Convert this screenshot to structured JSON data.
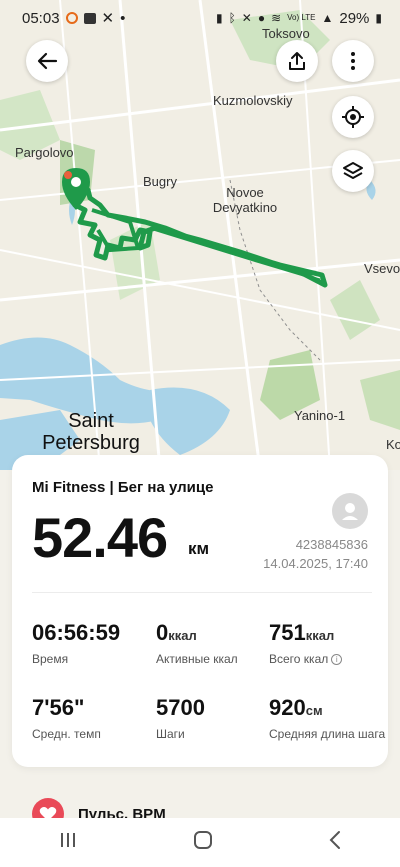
{
  "status_bar": {
    "time": "05:03",
    "battery": "29%",
    "network": "Vo) LTE"
  },
  "map": {
    "labels": {
      "toksovo": "Toksovo",
      "kuzmolovskiy": "Kuzmolovskiy",
      "pargolovo": "Pargolovo",
      "bugry": "Bugry",
      "novoe_devyatkino": "Novoe Devyatkino",
      "vsevo": "Vsevo",
      "saint_petersburg": "Saint Petersburg",
      "yanino": "Yanino-1",
      "ko": "Ko"
    },
    "route_color": "#1f9a4a"
  },
  "card": {
    "title": "Mi Fitness | Бег на улице",
    "distance_value": "52.46",
    "distance_unit": "км",
    "record_id": "4238845836",
    "datetime": "14.04.2025, 17:40",
    "stats": [
      {
        "value": "06:56:59",
        "unit": "",
        "label": "Время"
      },
      {
        "value": "0",
        "unit": "ккал",
        "label": "Активные ккал"
      },
      {
        "value": "751",
        "unit": "ккал",
        "label": "Всего ккал"
      },
      {
        "value": "7'56\"",
        "unit": "",
        "label": "Средн. темп"
      },
      {
        "value": "5700",
        "unit": "",
        "label": "Шаги"
      },
      {
        "value": "920",
        "unit": "см",
        "label": "Средняя длина шага"
      }
    ]
  },
  "heart_section": {
    "label": "Пульс, BPM"
  }
}
